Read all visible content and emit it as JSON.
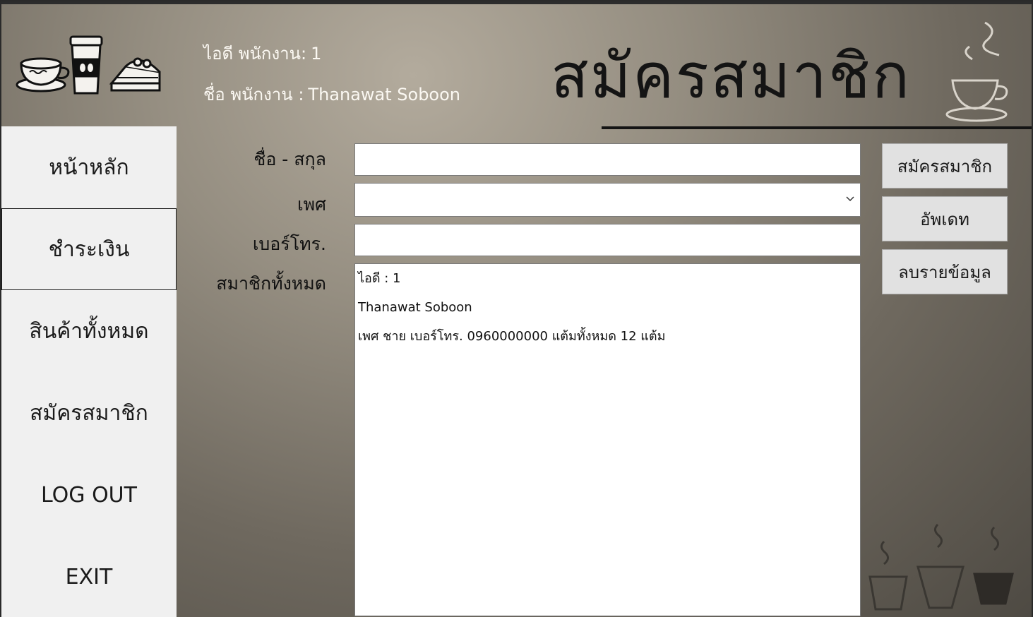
{
  "header": {
    "employee_id_label": "ไอดี พนักงาน:",
    "employee_id_value": "1",
    "employee_name_label": "ชื่อ พนักงาน :",
    "employee_name_value": "Thanawat Soboon",
    "page_title": "สมัครสมาชิก"
  },
  "sidebar": {
    "items": [
      {
        "label": "หน้าหลัก",
        "icon": "none"
      },
      {
        "label": "ชำระเงิน",
        "active": true
      },
      {
        "label": "สินค้าทั้งหมด"
      },
      {
        "label": "สมัครสมาชิก"
      },
      {
        "label": "LOG OUT"
      },
      {
        "label": "EXIT"
      }
    ]
  },
  "form": {
    "fullname_label": "ชื่อ - สกุล",
    "fullname_value": "",
    "gender_label": "เพศ",
    "gender_value": "",
    "phone_label": "เบอร์โทร.",
    "phone_value": "",
    "members_label": "สมาชิกทั้งหมด",
    "members_lines": [
      "ไอดี : 1",
      "Thanawat Soboon",
      "เพศ ชาย   เบอร์โทร. 0960000000 แต้มทั้งหมด 12 แต้ม"
    ]
  },
  "actions": {
    "register_label": "สมัครสมาชิก",
    "update_label": "อัพเดท",
    "delete_label": "ลบรายข้อมูล"
  },
  "icons": [
    "coffee-cup-saucer-icon",
    "takeaway-cup-icon",
    "cake-slice-icon",
    "steaming-cup-icon",
    "steaming-cups-icon",
    "chevron-down-icon"
  ],
  "colors": {
    "background_light": "#b3ab9d",
    "background_dark": "#4e4a43",
    "sidebar": "#f0f0f0",
    "button": "#e1e1e1",
    "header_text": "#fbf8f2",
    "title_text": "#141414"
  }
}
